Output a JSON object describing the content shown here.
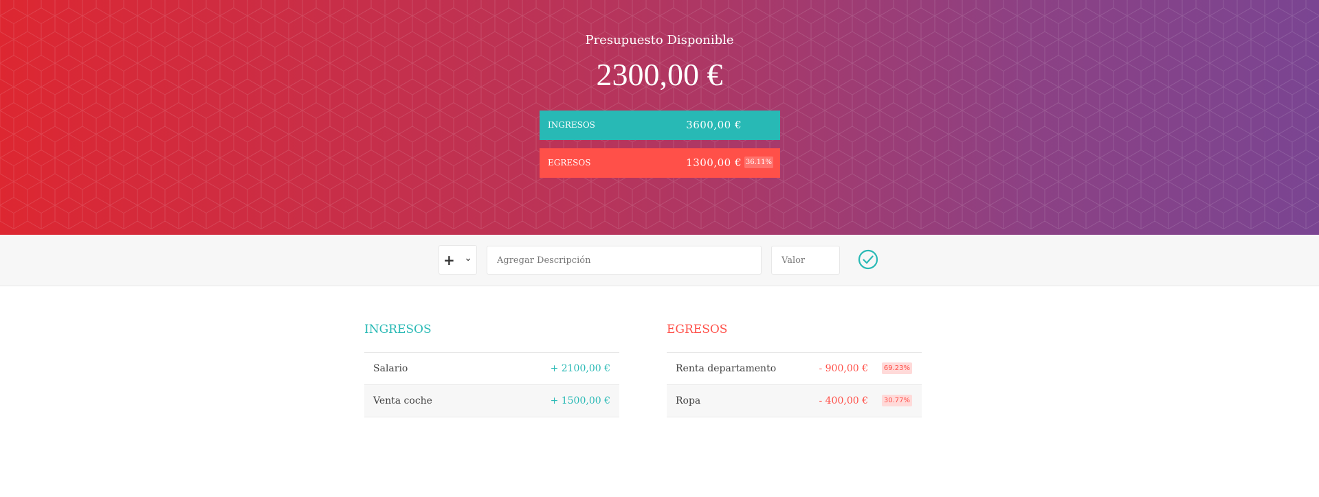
{
  "budget": {
    "title": "Presupuesto Disponible",
    "value": "2300,00 €",
    "income_label": "Ingresos",
    "income_value": "3600,00 €",
    "expense_label": "Egresos",
    "expense_value": "1300,00 €",
    "expense_percent": "36.11%"
  },
  "add_form": {
    "type_selected": "+",
    "description_placeholder": "Agregar Descripción",
    "value_placeholder": "Valor",
    "submit_icon": "check-circle-icon"
  },
  "income": {
    "title": "Ingresos",
    "items": [
      {
        "description": "Salario",
        "value": "+ 2100,00 €"
      },
      {
        "description": "Venta coche",
        "value": "+ 1500,00 €"
      }
    ]
  },
  "expenses": {
    "title": "Egresos",
    "items": [
      {
        "description": "Renta departamento",
        "value": "- 900,00 €",
        "percent": "69.23%"
      },
      {
        "description": "Ropa",
        "value": "- 400,00 €",
        "percent": "30.77%"
      }
    ]
  },
  "colors": {
    "income": "#28b9b5",
    "expense": "#ff5049",
    "gradient_start": "#dd2731",
    "gradient_end": "#7a4592"
  }
}
